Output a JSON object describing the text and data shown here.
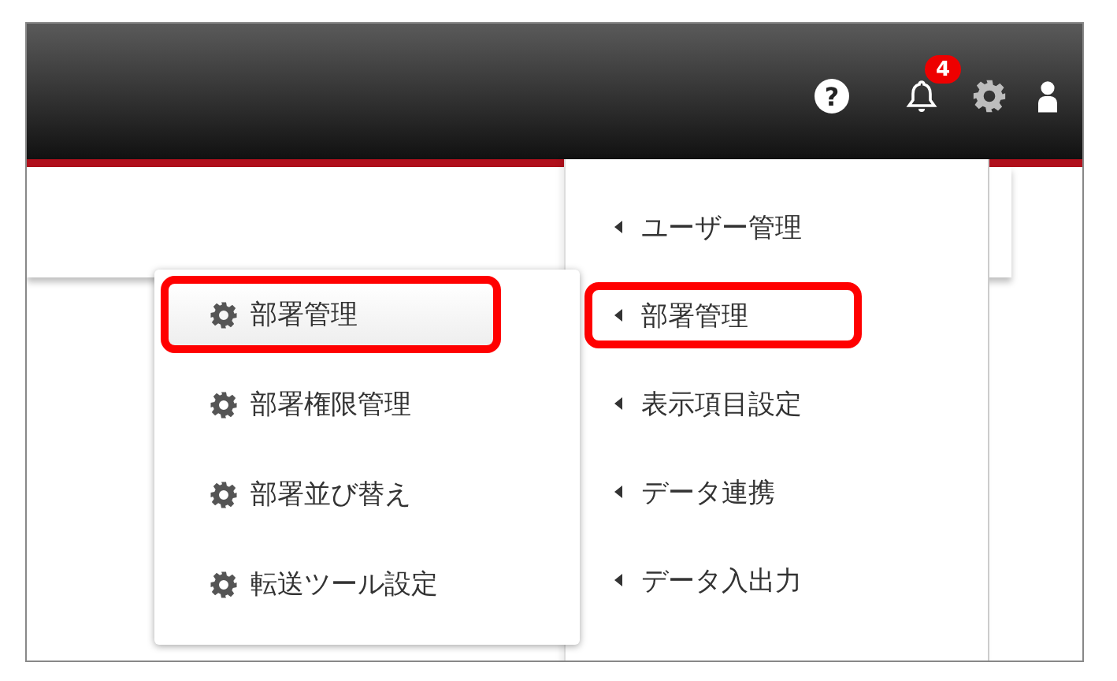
{
  "header": {
    "help": "?",
    "notifications": {
      "count": "4"
    }
  },
  "settings_menu": {
    "items": [
      {
        "label": "ユーザー管理",
        "highlighted": false
      },
      {
        "label": "部署管理",
        "highlighted": true
      },
      {
        "label": "表示項目設定",
        "highlighted": false
      },
      {
        "label": "データ連携",
        "highlighted": false
      },
      {
        "label": "データ入出力",
        "highlighted": false
      }
    ]
  },
  "submenu": {
    "items": [
      {
        "label": "部署管理",
        "selected": true,
        "highlighted": true
      },
      {
        "label": "部署権限管理",
        "selected": false,
        "highlighted": false
      },
      {
        "label": "部署並び替え",
        "selected": false,
        "highlighted": false
      },
      {
        "label": "転送ツール設定",
        "selected": false,
        "highlighted": false
      }
    ]
  }
}
